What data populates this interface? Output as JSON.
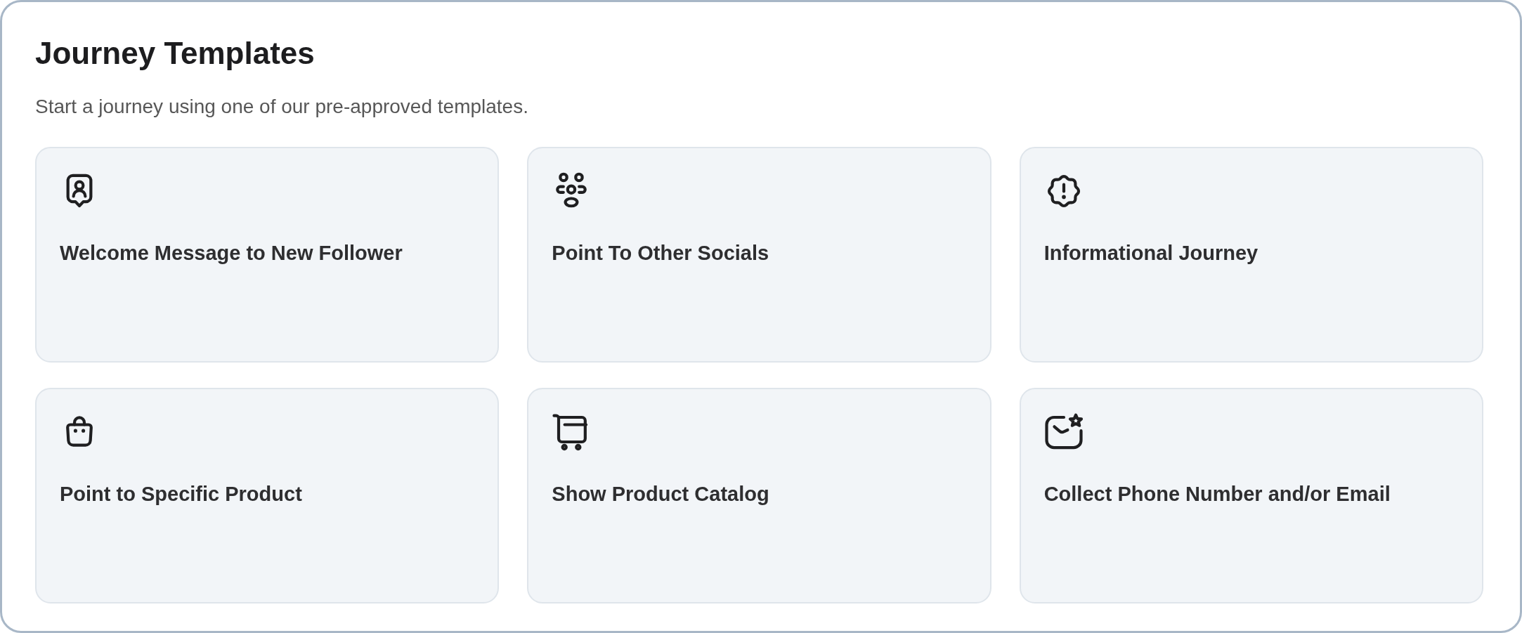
{
  "header": {
    "title": "Journey Templates",
    "subtitle": "Start a journey using one of our pre-approved templates."
  },
  "templates": [
    {
      "kind": "welcome",
      "title": "Welcome Message to New Follower"
    },
    {
      "kind": "socials",
      "title": "Point To Other Socials"
    },
    {
      "kind": "info",
      "title": "Informational Journey"
    },
    {
      "kind": "product",
      "title": "Point to Specific Product"
    },
    {
      "kind": "catalog",
      "title": "Show Product Catalog"
    },
    {
      "kind": "contact",
      "title": "Collect Phone Number and/or Email"
    }
  ]
}
